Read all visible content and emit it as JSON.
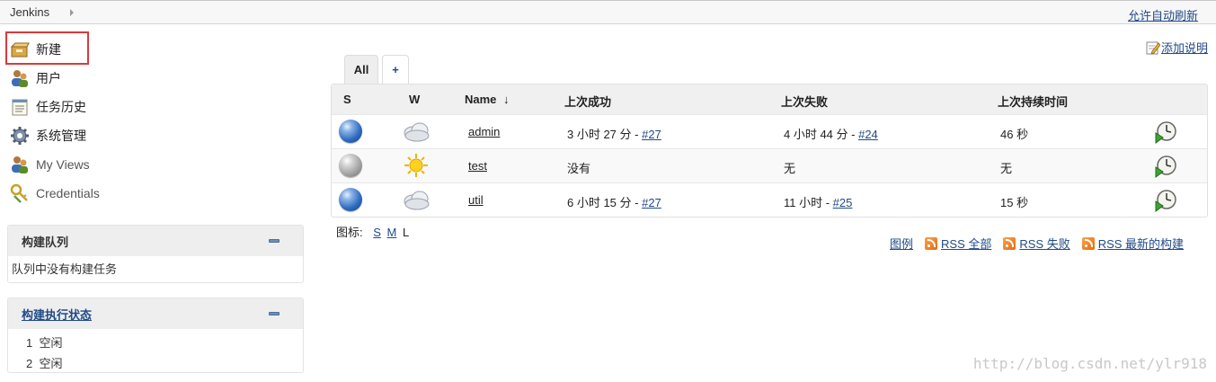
{
  "breadcrumb": {
    "root": "Jenkins"
  },
  "header": {
    "auto_refresh": "允许自动刷新"
  },
  "sidebar": {
    "tasks": [
      {
        "label": "新建",
        "icon": "new-item-icon"
      },
      {
        "label": "用户",
        "icon": "users-icon"
      },
      {
        "label": "任务历史",
        "icon": "build-history-icon"
      },
      {
        "label": "系统管理",
        "icon": "gear-icon"
      },
      {
        "label": "My Views",
        "icon": "users-icon"
      },
      {
        "label": "Credentials",
        "icon": "credentials-key-icon"
      }
    ],
    "build_queue": {
      "title": "构建队列",
      "empty_text": "队列中没有构建任务"
    },
    "executors": {
      "title": "构建执行状态",
      "rows": [
        {
          "num": "1",
          "state": "空闲"
        },
        {
          "num": "2",
          "state": "空闲"
        }
      ]
    }
  },
  "main": {
    "add_description": "添加说明",
    "tabs": [
      {
        "label": "All",
        "active": true
      },
      {
        "label": "+"
      }
    ],
    "table": {
      "headers": {
        "s": "S",
        "w": "W",
        "name": "Name",
        "sort": "↓",
        "last_success": "上次成功",
        "last_failure": "上次失败",
        "last_duration": "上次持续时间"
      },
      "rows": [
        {
          "status": "blue",
          "weather": "cloudy",
          "name": "admin",
          "success_time": "3 小时 27 分 - ",
          "success_build": "#27",
          "failure_time": "4 小时 44 分 - ",
          "failure_build": "#24",
          "duration": "46 秒"
        },
        {
          "status": "grey",
          "weather": "sunny",
          "name": "test",
          "success_time": "没有",
          "success_build": "",
          "failure_time": "无",
          "failure_build": "",
          "duration": "无"
        },
        {
          "status": "blue",
          "weather": "cloudy",
          "name": "util",
          "success_time": "6 小时 15 分 - ",
          "success_build": "#27",
          "failure_time": "11 小时 - ",
          "failure_build": "#25",
          "duration": "15 秒"
        }
      ]
    },
    "icon_size": {
      "label": "图标:",
      "s": "S",
      "m": "M",
      "l": "L"
    },
    "legend": "图例",
    "rss": [
      "RSS 全部",
      "RSS 失败",
      "RSS 最新的构建"
    ]
  },
  "watermark": "http://blog.csdn.net/ylr918",
  "colors": {
    "highlight": "#d93a3a",
    "link": "#204a87",
    "stable": "#2f6bc0",
    "notbuilt": "#9c9c9c"
  }
}
